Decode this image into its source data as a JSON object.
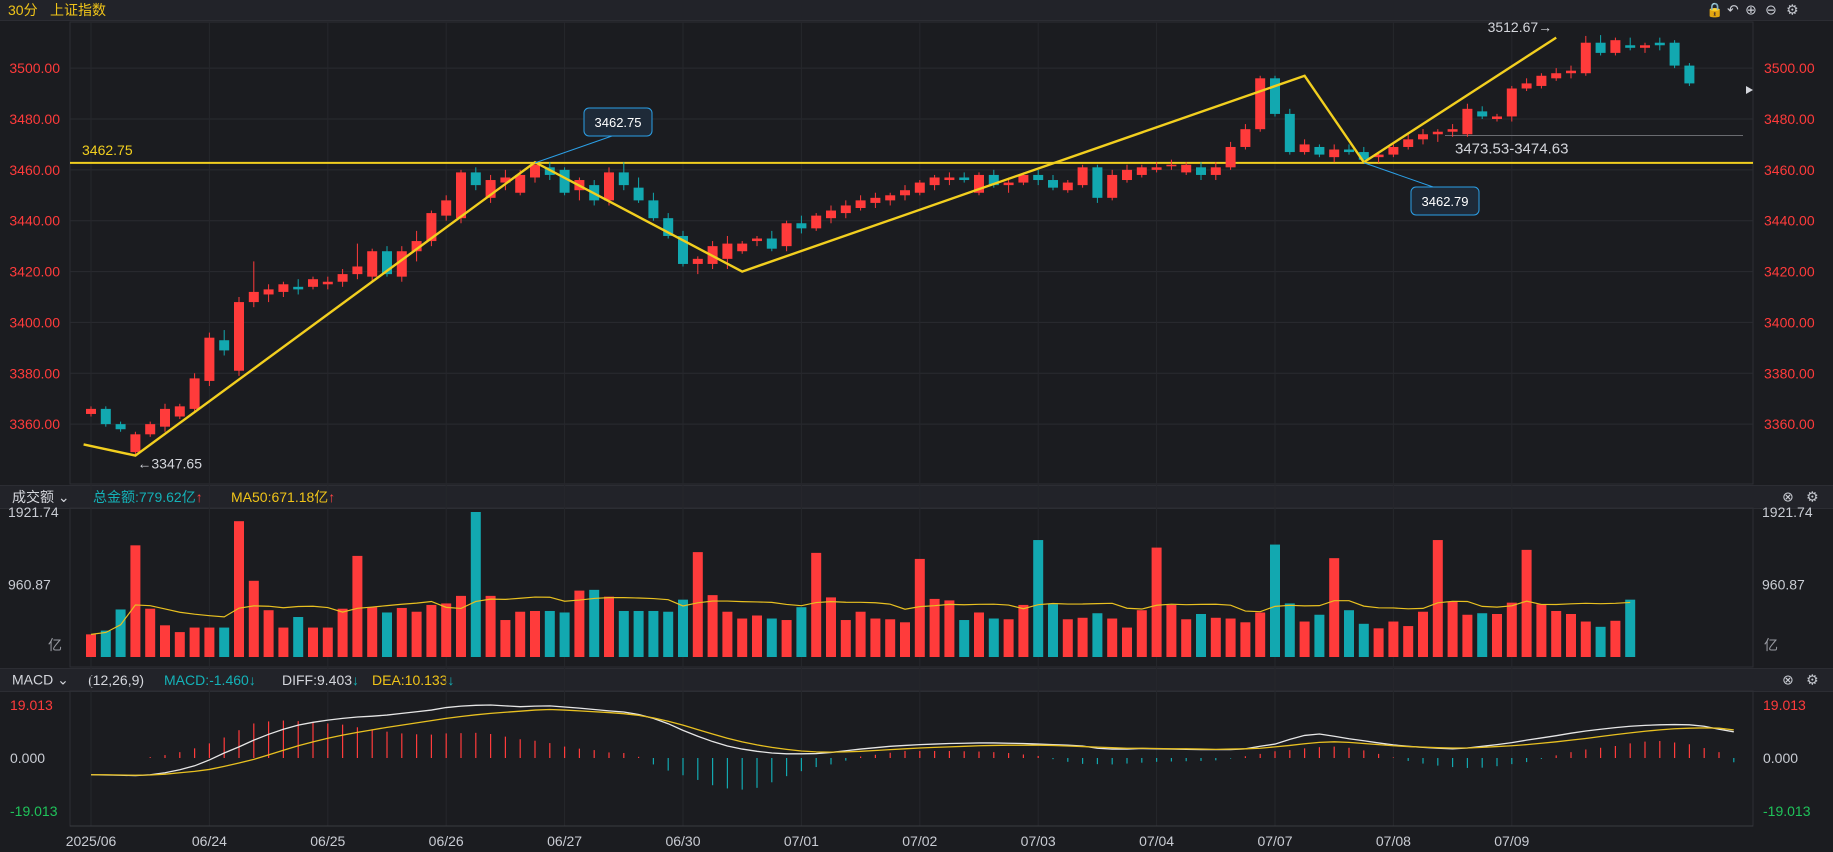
{
  "header": {
    "period": "30分",
    "symbol": "上证指数"
  },
  "volume_header": {
    "label": "成交额",
    "total_label": "总金额:779.62亿",
    "ma_label": "MA50:671.18亿",
    "unit": "亿"
  },
  "macd_header": {
    "label": "MACD",
    "params": "(12,26,9)",
    "macd": "MACD:-1.460",
    "diff": "DIFF:9.403",
    "dea": "DEA:10.133"
  },
  "colors": {
    "up": "#ff3b3b",
    "down": "#12a8b0",
    "ma": "#e8c020",
    "diff": "#e6e6e6",
    "trend": "#f2cf1f"
  },
  "chart_data": [
    {
      "type": "candlestick",
      "title": "",
      "ylim": [
        3340,
        3515
      ],
      "yticks": [
        3360,
        3380,
        3400,
        3420,
        3440,
        3460,
        3480,
        3500
      ],
      "x_labels": [
        "2025/06",
        "06/24",
        "06/25",
        "06/26",
        "06/27",
        "06/30",
        "07/01",
        "07/02",
        "07/03",
        "07/04",
        "07/07",
        "07/08",
        "07/09"
      ],
      "x_label_index": [
        0,
        8,
        16,
        24,
        32,
        40,
        48,
        56,
        64,
        72,
        80,
        88,
        96
      ],
      "levels": [
        {
          "value": 3462.75,
          "label": "3462.75"
        },
        {
          "value": 3473.53,
          "label": "3473.53-3474.63"
        }
      ],
      "annotations": [
        {
          "index": 3,
          "value": 3347.65,
          "label": "←3347.65"
        },
        {
          "index": 30,
          "value": 3462.75,
          "label": "3462.75"
        },
        {
          "index": 86,
          "value": 3462.79,
          "label": "3462.79"
        },
        {
          "index": 99,
          "value": 3512.67,
          "label": "3512.67→"
        }
      ],
      "trend_path": [
        [
          -0.5,
          3352
        ],
        [
          3,
          3347.65
        ],
        [
          30,
          3463
        ],
        [
          44,
          3420
        ],
        [
          82,
          3497
        ],
        [
          86,
          3463
        ],
        [
          99,
          3512
        ]
      ],
      "ohlc": [
        [
          3364,
          3367,
          3363,
          3366
        ],
        [
          3366,
          3367,
          3359,
          3360
        ],
        [
          3360,
          3361,
          3357,
          3358
        ],
        [
          3349,
          3357,
          3347.65,
          3356
        ],
        [
          3356,
          3361,
          3355,
          3360
        ],
        [
          3359,
          3368,
          3357,
          3366
        ],
        [
          3363,
          3368,
          3362,
          3367
        ],
        [
          3366,
          3380,
          3365,
          3378
        ],
        [
          3377,
          3396,
          3375,
          3394
        ],
        [
          3393,
          3397,
          3387,
          3389
        ],
        [
          3381,
          3410,
          3379,
          3408
        ],
        [
          3408,
          3424,
          3406,
          3412
        ],
        [
          3411,
          3415,
          3408,
          3413
        ],
        [
          3412,
          3416,
          3410,
          3415
        ],
        [
          3414,
          3417,
          3411,
          3413
        ],
        [
          3414,
          3418,
          3413,
          3417
        ],
        [
          3415,
          3418,
          3413,
          3416
        ],
        [
          3416,
          3421,
          3414,
          3419
        ],
        [
          3419,
          3431,
          3417,
          3422
        ],
        [
          3418,
          3429,
          3416,
          3428
        ],
        [
          3428,
          3430,
          3418,
          3419
        ],
        [
          3418,
          3430,
          3416,
          3428
        ],
        [
          3428,
          3436,
          3424,
          3432
        ],
        [
          3432,
          3444,
          3430,
          3443
        ],
        [
          3442,
          3450,
          3440,
          3448
        ],
        [
          3441,
          3460,
          3439,
          3459
        ],
        [
          3459,
          3461,
          3452,
          3454
        ],
        [
          3449,
          3458,
          3447,
          3456
        ],
        [
          3455,
          3460,
          3452,
          3457
        ],
        [
          3451,
          3460,
          3450,
          3458
        ],
        [
          3457,
          3463,
          3455,
          3462
        ],
        [
          3461,
          3463,
          3456,
          3458
        ],
        [
          3460,
          3461,
          3450,
          3451
        ],
        [
          3452,
          3457,
          3448,
          3456
        ],
        [
          3454,
          3456,
          3446,
          3448
        ],
        [
          3448,
          3461,
          3446,
          3459
        ],
        [
          3459,
          3463,
          3452,
          3454
        ],
        [
          3453,
          3457,
          3447,
          3448
        ],
        [
          3448,
          3451,
          3440,
          3441
        ],
        [
          3441,
          3443,
          3433,
          3434
        ],
        [
          3434,
          3436,
          3422,
          3423
        ],
        [
          3423,
          3426,
          3419,
          3425
        ],
        [
          3423,
          3432,
          3421,
          3430
        ],
        [
          3425,
          3434,
          3421,
          3431
        ],
        [
          3428,
          3432,
          3427,
          3431
        ],
        [
          3432,
          3434,
          3430,
          3433
        ],
        [
          3433,
          3436,
          3428,
          3429
        ],
        [
          3430,
          3440,
          3428,
          3439
        ],
        [
          3439,
          3442,
          3435,
          3437
        ],
        [
          3437,
          3443,
          3436,
          3442
        ],
        [
          3441,
          3446,
          3439,
          3444
        ],
        [
          3443,
          3448,
          3441,
          3446
        ],
        [
          3445,
          3450,
          3444,
          3448
        ],
        [
          3447,
          3451,
          3445,
          3449
        ],
        [
          3448,
          3451,
          3446,
          3450
        ],
        [
          3450,
          3454,
          3448,
          3452
        ],
        [
          3451,
          3456,
          3450,
          3455
        ],
        [
          3454,
          3458,
          3452,
          3457
        ],
        [
          3456,
          3459,
          3454,
          3457
        ],
        [
          3457,
          3459,
          3455,
          3456
        ],
        [
          3451,
          3459,
          3450,
          3458
        ],
        [
          3458,
          3460,
          3453,
          3454
        ],
        [
          3454,
          3457,
          3451,
          3455
        ],
        [
          3455,
          3459,
          3454,
          3458
        ],
        [
          3458,
          3460,
          3454,
          3456
        ],
        [
          3456,
          3458,
          3452,
          3453
        ],
        [
          3452,
          3456,
          3451,
          3455
        ],
        [
          3454,
          3462,
          3453,
          3461
        ],
        [
          3461,
          3462,
          3447,
          3449
        ],
        [
          3449,
          3460,
          3448,
          3458
        ],
        [
          3456,
          3462,
          3455,
          3460
        ],
        [
          3458,
          3462,
          3457,
          3461
        ],
        [
          3460,
          3463,
          3459,
          3461
        ],
        [
          3462,
          3464,
          3460,
          3462
        ],
        [
          3459,
          3463,
          3458,
          3462
        ],
        [
          3461,
          3463,
          3456,
          3458
        ],
        [
          3458,
          3463,
          3456,
          3461
        ],
        [
          3461,
          3471,
          3460,
          3469
        ],
        [
          3469,
          3478,
          3468,
          3476
        ],
        [
          3476,
          3497,
          3475,
          3496
        ],
        [
          3496,
          3497,
          3481,
          3482
        ],
        [
          3482,
          3484,
          3466,
          3467
        ],
        [
          3467,
          3472,
          3466,
          3470
        ],
        [
          3469,
          3470,
          3465,
          3466
        ],
        [
          3465,
          3470,
          3463,
          3468
        ],
        [
          3468,
          3470,
          3466,
          3467
        ],
        [
          3467,
          3469,
          3463,
          3464
        ],
        [
          3465,
          3467,
          3462.79,
          3466
        ],
        [
          3466,
          3470,
          3465,
          3469
        ],
        [
          3469,
          3474,
          3468,
          3472
        ],
        [
          3472,
          3476,
          3470,
          3474
        ],
        [
          3474,
          3476,
          3471,
          3475
        ],
        [
          3475,
          3478,
          3473,
          3476
        ],
        [
          3474,
          3486,
          3473,
          3484
        ],
        [
          3483,
          3485,
          3480,
          3481
        ],
        [
          3480,
          3482,
          3479,
          3481
        ],
        [
          3481,
          3493,
          3479,
          3492
        ],
        [
          3492,
          3496,
          3491,
          3494
        ],
        [
          3493,
          3498,
          3492,
          3497
        ],
        [
          3496,
          3500,
          3495,
          3498
        ],
        [
          3498,
          3501,
          3496,
          3499
        ],
        [
          3498,
          3512.67,
          3497,
          3510
        ],
        [
          3510,
          3513,
          3505,
          3506
        ],
        [
          3506,
          3512,
          3505,
          3511
        ],
        [
          3509,
          3512,
          3507,
          3508
        ],
        [
          3508,
          3510,
          3506,
          3509
        ],
        [
          3510,
          3512,
          3507,
          3509
        ],
        [
          3510,
          3511,
          3500,
          3501
        ],
        [
          3501,
          3502,
          3493,
          3494
        ]
      ]
    },
    {
      "type": "bar",
      "title": "成交额",
      "ylim": [
        0,
        1921.74
      ],
      "yticks": [
        960.87,
        1921.74
      ],
      "ytick_labels": [
        "960.87",
        "1921.74"
      ],
      "values": [
        300,
        350,
        630,
        1480,
        640,
        420,
        330,
        390,
        390,
        390,
        1800,
        1010,
        620,
        390,
        530,
        390,
        390,
        640,
        1340,
        660,
        590,
        650,
        600,
        690,
        710,
        810,
        1921.74,
        810,
        490,
        600,
        610,
        610,
        590,
        880,
        890,
        800,
        610,
        610,
        610,
        600,
        760,
        1390,
        820,
        600,
        510,
        550,
        510,
        490,
        660,
        1380,
        790,
        490,
        600,
        510,
        500,
        460,
        1300,
        770,
        750,
        490,
        590,
        510,
        500,
        690,
        1550,
        700,
        500,
        520,
        580,
        510,
        390,
        620,
        1450,
        690,
        500,
        570,
        520,
        510,
        460,
        590,
        1490,
        710,
        470,
        560,
        1310,
        620,
        440,
        380,
        470,
        410,
        600,
        1550,
        730,
        560,
        580,
        570,
        720,
        1420,
        700,
        610,
        570,
        470,
        400,
        480,
        760
      ]
    },
    {
      "type": "line",
      "title": "MACD",
      "ylim": [
        -19.013,
        19.013
      ],
      "yticks": [
        -19.013,
        0,
        19.013
      ],
      "ytick_labels": [
        "-19.013",
        "0.000",
        "19.013"
      ],
      "series": [
        {
          "name": "DIFF",
          "values": [
            -6,
            -6.1,
            -6.2,
            -6.3,
            -6,
            -5.3,
            -4.2,
            -2.8,
            -0.7,
            1.8,
            4,
            6.4,
            8.5,
            10.3,
            11.8,
            12.8,
            13.6,
            14.2,
            14.7,
            15,
            15.4,
            16,
            16.6,
            17.2,
            18.1,
            18.6,
            18.9,
            19,
            18.7,
            18.4,
            18.6,
            18.7,
            18.3,
            17.9,
            17.4,
            16.9,
            16.5,
            15.6,
            14.2,
            12.3,
            9.9,
            7.8,
            5.9,
            4.3,
            3.2,
            2.4,
            1.8,
            1.5,
            1.5,
            1.6,
            2,
            2.6,
            3.2,
            3.7,
            4.2,
            4.5,
            4.8,
            5.0,
            5.2,
            5.3,
            5.4,
            5.4,
            5.3,
            5.2,
            5.0,
            4.8,
            4.6,
            4.3,
            3.5,
            3.2,
            3.2,
            3.4,
            3.3,
            3.2,
            3.1,
            3.0,
            3.0,
            3.0,
            3.3,
            4.2,
            5.0,
            6.7,
            8.1,
            8.6,
            7.8,
            6.9,
            6.2,
            5.4,
            4.7,
            4.2,
            3.8,
            3.5,
            3.3,
            3.6,
            4.2,
            4.8,
            5.5,
            6.4,
            7.2,
            8.0,
            8.9,
            9.7,
            10.3,
            10.9,
            11.4,
            11.7,
            11.9,
            12.0,
            11.9,
            11.4,
            10.3,
            9.4
          ]
        },
        {
          "name": "DEA",
          "values": [
            -6,
            -6,
            -6.1,
            -6.2,
            -6.1,
            -5.8,
            -5.3,
            -4.8,
            -4.1,
            -3,
            -1.8,
            -0.5,
            1.1,
            2.8,
            4.4,
            5.8,
            7.1,
            8.2,
            9.2,
            10.1,
            11,
            11.8,
            12.6,
            13.4,
            14.2,
            14.9,
            15.5,
            16,
            16.4,
            16.8,
            17.2,
            17.4,
            17.2,
            16.9,
            16.6,
            16.3,
            15.9,
            15.3,
            14.4,
            13.2,
            11.8,
            10.2,
            8.6,
            7.1,
            5.8,
            4.7,
            3.8,
            3.1,
            2.5,
            2.2,
            2.1,
            2.2,
            2.4,
            2.7,
            3.0,
            3.3,
            3.6,
            3.8,
            4.0,
            4.2,
            4.4,
            4.5,
            4.6,
            4.6,
            4.6,
            4.5,
            4.3,
            4.1,
            3.9,
            3.7,
            3.5,
            3.5,
            3.4,
            3.3,
            3.3,
            3.2,
            3.1,
            3.2,
            3.3,
            3.5,
            4.0,
            4.5,
            5.1,
            5.6,
            5.8,
            5.6,
            5.2,
            4.8,
            4.4,
            4.1,
            3.9,
            3.7,
            3.6,
            3.6,
            3.8,
            4.1,
            4.4,
            4.8,
            5.3,
            5.8,
            6.4,
            7.0,
            7.7,
            8.4,
            9.0,
            9.6,
            10.1,
            10.5,
            10.7,
            10.8,
            10.7,
            10.1
          ]
        }
      ],
      "histogram": [
        0,
        0,
        0,
        0,
        0.3,
        1,
        2,
        3.3,
        5,
        7,
        9.5,
        11.8,
        12.5,
        12.8,
        12.6,
        12.3,
        11.8,
        11.4,
        10.5,
        9.8,
        9,
        8.4,
        8.1,
        8,
        8.4,
        8.5,
        8.6,
        8.2,
        7.3,
        6.4,
        5.9,
        5.1,
        3.9,
        3.2,
        2.7,
        1.9,
        1.7,
        0.4,
        -2.2,
        -4.3,
        -5.9,
        -7.5,
        -9.3,
        -10.4,
        -10.8,
        -10.2,
        -8.3,
        -6.2,
        -4.5,
        -3.1,
        -2.2,
        -0.9,
        0.5,
        1.1,
        1.8,
        2.4,
        2.4,
        2.4,
        2.4,
        2.3,
        2.2,
        2.0,
        1.7,
        1.2,
        0.7,
        -0.4,
        -1.3,
        -2.0,
        -2.1,
        -2.2,
        -1.9,
        -1.6,
        -1.3,
        -1.2,
        -1.1,
        -1.0,
        -0.8,
        -0.2,
        0.6,
        1.4,
        2.3,
        2.7,
        3.3,
        3.7,
        3.9,
        3.5,
        2.6,
        1.4,
        0.2,
        -1.0,
        -1.9,
        -2.6,
        -3.1,
        -3.4,
        -3.3,
        -2.8,
        -2.1,
        -1.4,
        -0.3,
        0.9,
        2.0,
        2.9,
        3.5,
        4.1,
        5,
        5.6,
        5.8,
        5.3,
        4.7,
        3.4,
        2.0,
        -1.46
      ]
    }
  ]
}
